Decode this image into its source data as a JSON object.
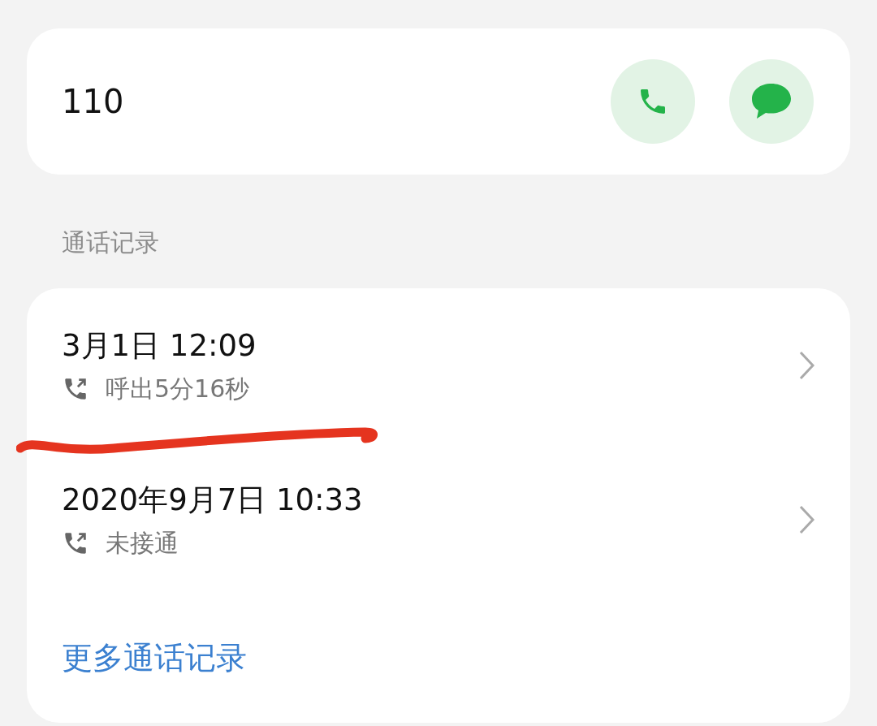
{
  "contact": {
    "number": "110"
  },
  "section_title": "通话记录",
  "calls": [
    {
      "time": "3月1日 12:09",
      "detail": "呼出5分16秒"
    },
    {
      "time": "2020年9月7日 10:33",
      "detail": "未接通"
    }
  ],
  "more_link": "更多通话记录"
}
